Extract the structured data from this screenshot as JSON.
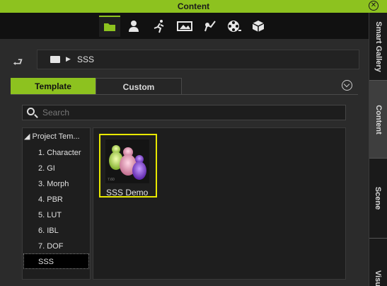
{
  "window": {
    "title": "Content"
  },
  "toolbar": {
    "icons": [
      "folder-icon",
      "avatar-icon",
      "motion-icon",
      "stage-icon",
      "props-icon",
      "film-reel-icon",
      "cube-box-icon"
    ]
  },
  "path": {
    "segments": [
      "SSS"
    ]
  },
  "tabs": {
    "template_label": "Template",
    "custom_label": "Custom"
  },
  "search": {
    "placeholder": "Search"
  },
  "tree": {
    "root_label": "◢ Project Tem...",
    "items": [
      "1. Character",
      "2. GI",
      "3. Morph",
      "4. PBR",
      "5. LUT",
      "6. IBL",
      "7. DOF",
      "SSS"
    ],
    "selected": "SSS"
  },
  "content": {
    "items": [
      {
        "label": "SSS Demo",
        "thumb_caption": "7.60"
      }
    ]
  },
  "side_tabs": [
    "Smart Gallery",
    "Content",
    "Scene",
    "Visual"
  ],
  "colors": {
    "accent": "#8dc21f",
    "selection_border": "#e8e800"
  }
}
